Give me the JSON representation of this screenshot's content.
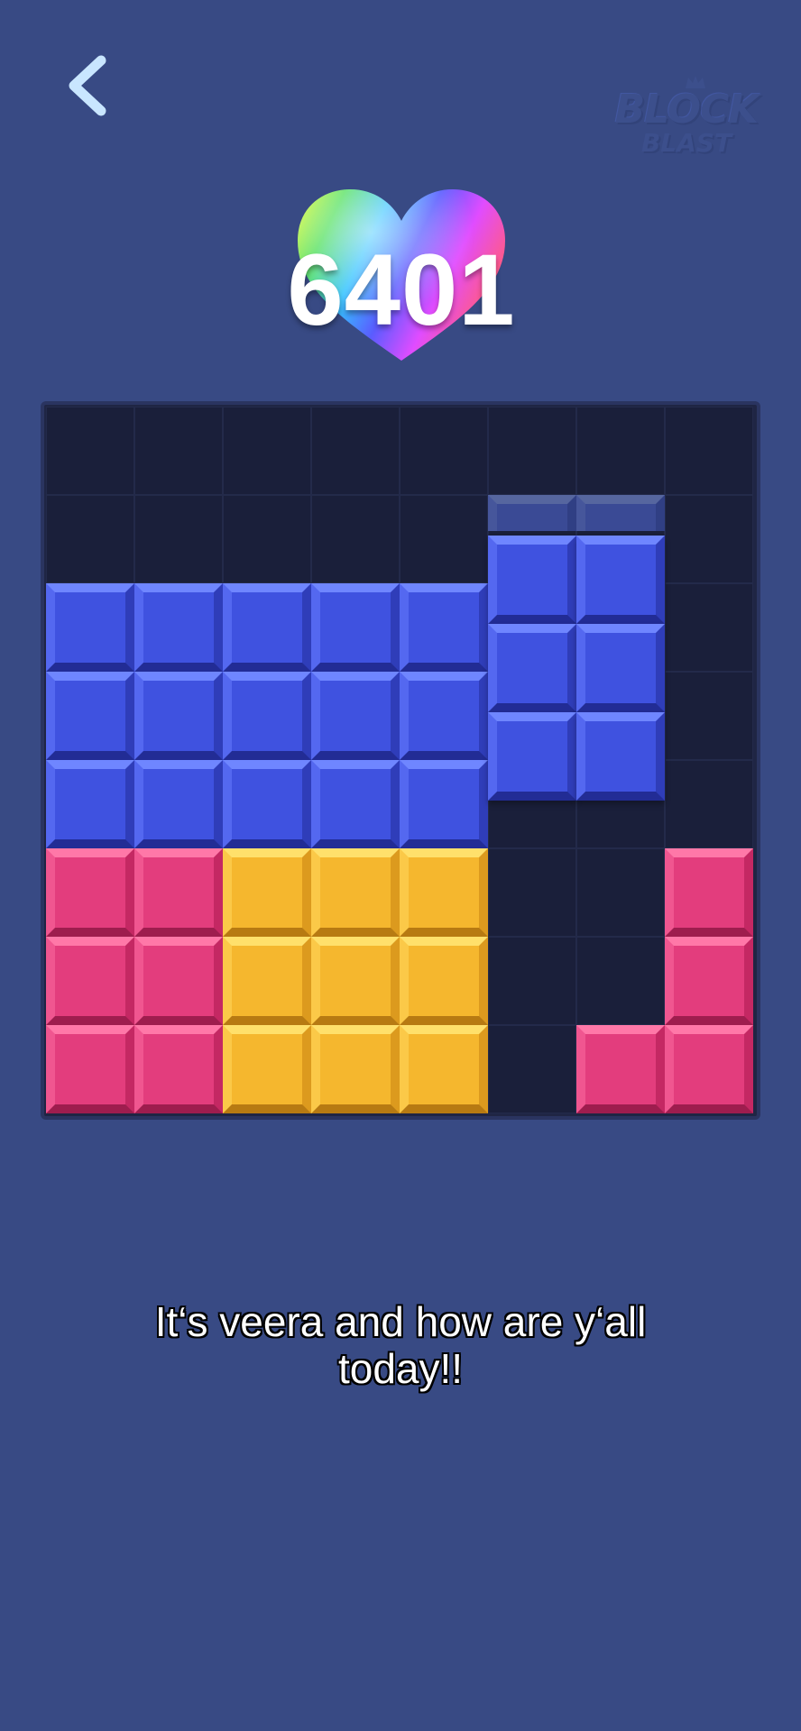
{
  "header": {
    "back_icon": "chevron-left-icon",
    "logo_line1": "BLOCK",
    "logo_line2": "BLAST"
  },
  "score": {
    "value": "6401",
    "badge_icon": "rainbow-heart-icon"
  },
  "board": {
    "rows": 8,
    "cols": 8,
    "colors": {
      "blue": "#3f52e0",
      "pink": "#e33d7d",
      "gold": "#f5b72e",
      "empty": "#1a1f3a",
      "background": "#384a84"
    },
    "grid": [
      [
        "empty",
        "empty",
        "empty",
        "empty",
        "empty",
        "empty",
        "empty",
        "empty"
      ],
      [
        "empty",
        "empty",
        "empty",
        "empty",
        "empty",
        "ghost",
        "ghost",
        "empty"
      ],
      [
        "blue",
        "blue",
        "blue",
        "blue",
        "blue",
        "empty",
        "empty",
        "empty"
      ],
      [
        "blue",
        "blue",
        "blue",
        "blue",
        "blue",
        "empty",
        "empty",
        "empty"
      ],
      [
        "blue",
        "blue",
        "blue",
        "blue",
        "blue",
        "empty",
        "empty",
        "empty"
      ],
      [
        "pink",
        "pink",
        "gold",
        "gold",
        "gold",
        "empty",
        "empty",
        "pink"
      ],
      [
        "pink",
        "pink",
        "gold",
        "gold",
        "gold",
        "empty",
        "empty",
        "pink"
      ],
      [
        "pink",
        "pink",
        "gold",
        "gold",
        "gold",
        "empty",
        "pink",
        "pink"
      ]
    ],
    "dragged_piece": {
      "color": "blue",
      "rows": 3,
      "cols": 2
    }
  },
  "caption": {
    "line1": "It‘s veera and how are y‘all",
    "line2": "today!!"
  }
}
